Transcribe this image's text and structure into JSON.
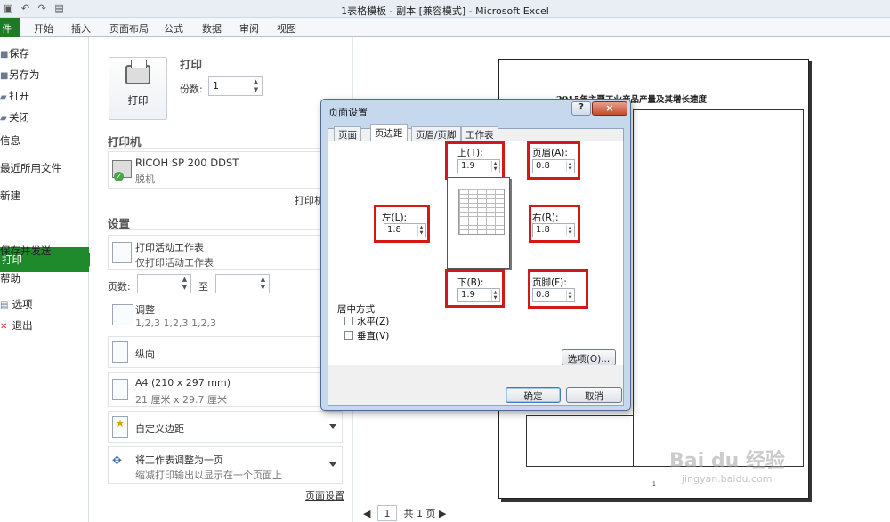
{
  "window": {
    "title": "1表格模板 - 副本  [兼容模式]  -  Microsoft Excel"
  },
  "ribbon": {
    "file_tab": "件",
    "tabs": [
      "开始",
      "插入",
      "页面布局",
      "公式",
      "数据",
      "审阅",
      "视图"
    ]
  },
  "nav": {
    "save": "保存",
    "save_as": "另存为",
    "open": "打开",
    "close": "关闭",
    "info": "信息",
    "recent": "最近所用文件",
    "new": "新建",
    "print": "打印",
    "save_send": "保存并发送",
    "help": "帮助",
    "options": "选项",
    "exit": "退出"
  },
  "print_panel": {
    "print_button": "打印",
    "print_heading": "打印",
    "copies_label": "份数:",
    "copies_value": "1",
    "printer_heading": "打印机",
    "printer_name": "RICOH SP 200 DDST",
    "printer_status": "脱机",
    "printer_props_link": "打印机",
    "settings_heading": "设置",
    "scope_title": "打印活动工作表",
    "scope_sub": "仅打印活动工作表",
    "pages_label": "页数:",
    "to_label": "至",
    "collate_title": "调整",
    "collate_sub": "1,2,3    1,2,3    1,2,3",
    "orientation": "纵向",
    "paper_title": "A4 (210 x 297 mm)",
    "paper_sub": "21 厘米 x 29.7 厘米",
    "margins": "自定义边距",
    "scaling_title": "将工作表调整为一页",
    "scaling_sub": "缩减打印输出以显示在一个页面上",
    "page_setup_link": "页面设置"
  },
  "preview": {
    "paper_title": "2015年主要工业产品产量及其增长速度",
    "page_num": "1",
    "current_page": "1",
    "total_pages": "共 1 页"
  },
  "dialog": {
    "title": "页面设置",
    "help": "?",
    "close": "×",
    "tabs": [
      "页面",
      "页边距",
      "页眉/页脚",
      "工作表"
    ],
    "active_tab": 1,
    "top_label": "上(T):",
    "top_value": "1.9",
    "header_label": "页眉(A):",
    "header_value": "0.8",
    "left_label": "左(L):",
    "left_value": "1.8",
    "right_label": "右(R):",
    "right_value": "1.8",
    "bottom_label": "下(B):",
    "bottom_value": "1.9",
    "footer_label": "页脚(F):",
    "footer_value": "0.8",
    "center_group": "居中方式",
    "horizontal": "水平(Z)",
    "vertical": "垂直(V)",
    "options_button": "选项(O)...",
    "ok": "确定",
    "cancel": "取消"
  },
  "watermark": {
    "brand": "Bai du 经验",
    "url": "jingyan.baidu.com"
  },
  "colors": {
    "accent": "#1f8a2c",
    "highlight": "#d41818",
    "dialog_frame": "#c6d8ee"
  }
}
